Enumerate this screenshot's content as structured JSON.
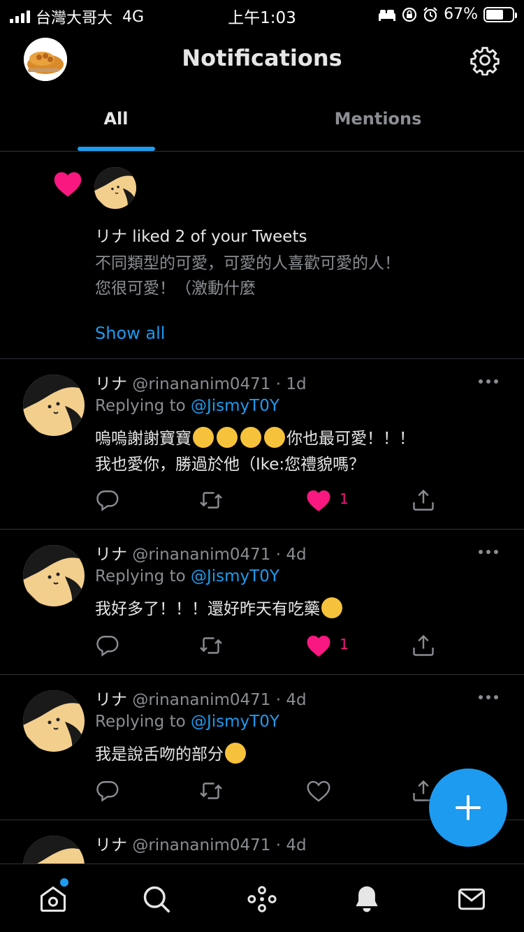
{
  "status_bar": {
    "carrier": "台灣大哥大",
    "network": "4G",
    "time": "上午1:03",
    "battery": "67%",
    "battery_level": 0.67
  },
  "header": {
    "title": "Notifications"
  },
  "tabs": [
    {
      "label": "All",
      "active": true
    },
    {
      "label": "Mentions",
      "active": false
    }
  ],
  "like_notification": {
    "text": "リナ liked 2 of your Tweets",
    "preview_line1": "不同類型的可愛，可愛的人喜歡可愛的人！",
    "preview_line2": "您很可愛！（激動什麼",
    "show_all": "Show all"
  },
  "tweets": [
    {
      "name": "リナ",
      "handle": "@rinananim0471 · 1d",
      "reply_prefix": "Replying to ",
      "reply_to": "@JismyT0Y",
      "line1_a": "嗚嗚謝謝寶寶",
      "line1_b": "你也最可愛！！！",
      "line2": "我也愛你，勝過於他（Ike:您禮貌嗎？",
      "likes": "1",
      "liked": true
    },
    {
      "name": "リナ",
      "handle": "@rinananim0471 · 4d",
      "reply_prefix": "Replying to ",
      "reply_to": "@JismyT0Y",
      "line1_a": "我好多了！！！還好昨天有吃藥",
      "likes": "1",
      "liked": true
    },
    {
      "name": "リナ",
      "handle": "@rinananim0471 · 4d",
      "reply_prefix": "Replying to ",
      "reply_to": "@JismyT0Y",
      "line1_a": "我是說舌吻的部分",
      "likes": "",
      "liked": false
    },
    {
      "name": "リナ",
      "handle": "@rinananim0471 · 4d"
    }
  ],
  "icons": {
    "nav": [
      "home-icon",
      "search-icon",
      "spaces-icon",
      "notifications-icon",
      "messages-icon"
    ],
    "fab": "compose-icon"
  },
  "colors": {
    "accent": "#1d9bf0",
    "like": "#f91880",
    "background": "#000000",
    "secondary_text": "#8a8d91"
  }
}
